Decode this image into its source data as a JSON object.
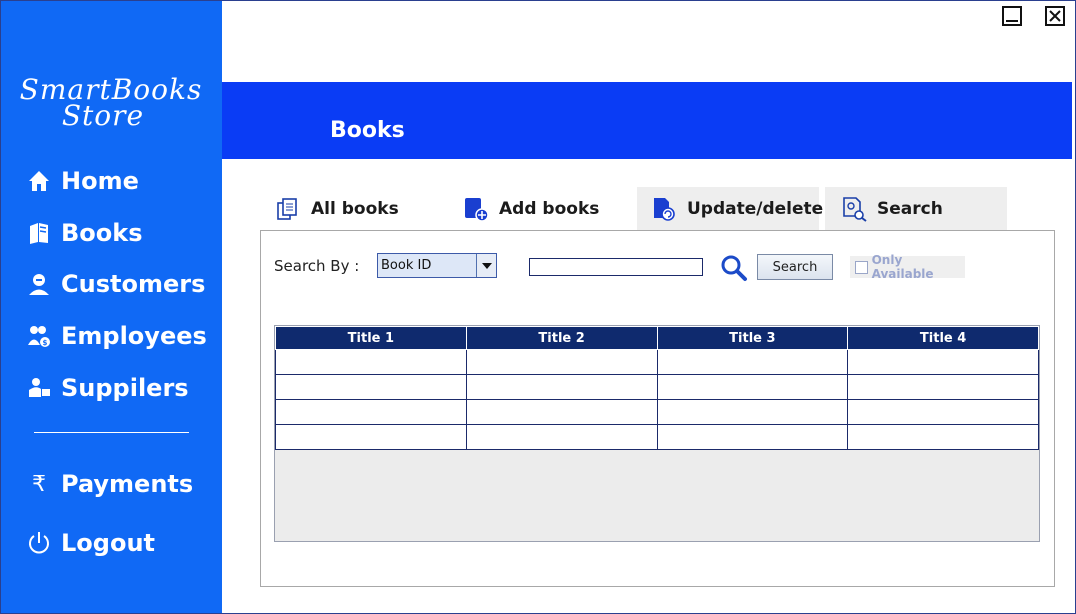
{
  "app": {
    "logo_line1": "SmartBooks",
    "logo_line2": "Store",
    "page_title": "Books"
  },
  "sidebar": {
    "items": [
      {
        "label": "Home",
        "icon": "home-icon"
      },
      {
        "label": "Books",
        "icon": "books-icon"
      },
      {
        "label": "Customers",
        "icon": "customer-icon"
      },
      {
        "label": "Employees",
        "icon": "employees-icon"
      },
      {
        "label": "Suppilers",
        "icon": "supplier-icon"
      },
      {
        "label": "Payments",
        "icon": "rupee-icon"
      },
      {
        "label": "Logout",
        "icon": "power-icon"
      }
    ]
  },
  "tabs": [
    {
      "label": "All books",
      "icon": "all-books-icon"
    },
    {
      "label": "Add books",
      "icon": "add-book-icon"
    },
    {
      "label": "Update/delete",
      "icon": "update-book-icon"
    },
    {
      "label": "Search",
      "icon": "search-book-icon"
    }
  ],
  "search": {
    "label": "Search By :",
    "select_value": "Book ID",
    "input_value": "",
    "button_label": "Search",
    "only_available_label": "Only Available"
  },
  "table": {
    "headers": [
      "Title 1",
      "Title 2",
      "Title 3",
      "Title 4"
    ]
  },
  "colors": {
    "sidebar": "#1069f5",
    "header": "#0a3cf5",
    "table_header": "#0f2a6e"
  }
}
